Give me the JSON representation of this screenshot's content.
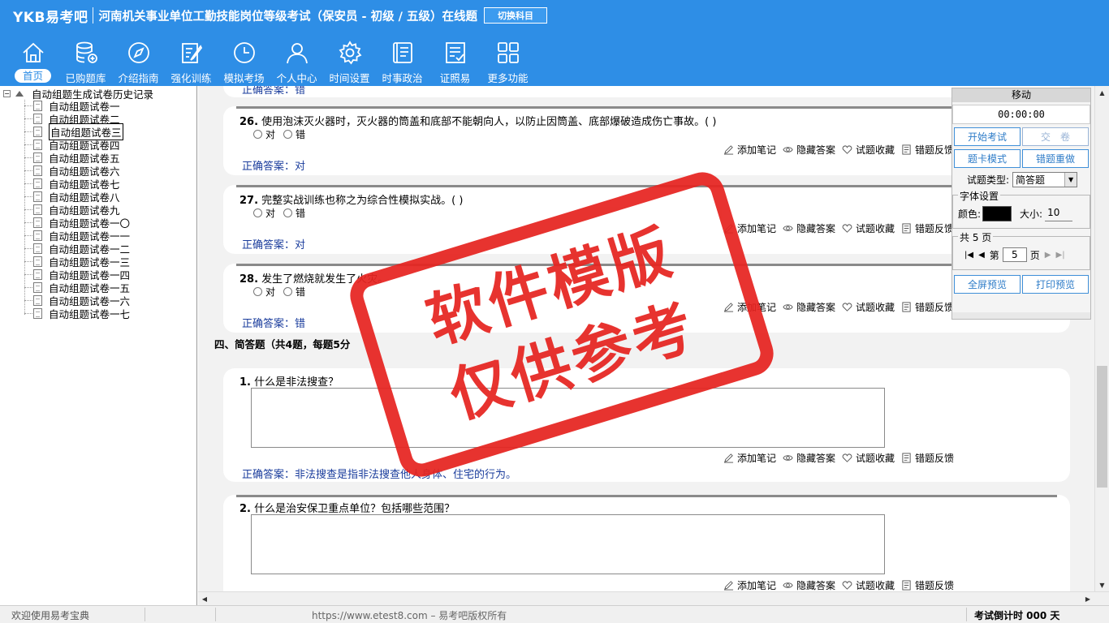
{
  "app": {
    "brand": "YKB易考吧",
    "title": "河南机关事业单位工勤技能岗位等级考试（保安员 - 初级 / 五级）在线题",
    "switch_subject": "切换科目"
  },
  "nav": [
    {
      "label": "首页",
      "icon": "home-icon"
    },
    {
      "label": "已购题库",
      "icon": "database-icon"
    },
    {
      "label": "介绍指南",
      "icon": "compass-icon"
    },
    {
      "label": "强化训练",
      "icon": "edit-icon"
    },
    {
      "label": "模拟考场",
      "icon": "clock-icon"
    },
    {
      "label": "个人中心",
      "icon": "user-icon"
    },
    {
      "label": "时间设置",
      "icon": "gear-icon"
    },
    {
      "label": "时事政治",
      "icon": "book-icon"
    },
    {
      "label": "证照易",
      "icon": "checklist-icon"
    },
    {
      "label": "更多功能",
      "icon": "grid-icon"
    }
  ],
  "tree": {
    "root": "自动组题生成试卷历史记录",
    "items": [
      "自动组题试卷一",
      "自动组题试卷二",
      "自动组题试卷三",
      "自动组题试卷四",
      "自动组题试卷五",
      "自动组题试卷六",
      "自动组题试卷七",
      "自动组题试卷八",
      "自动组题试卷九",
      "自动组题试卷一〇",
      "自动组题试卷一一",
      "自动组题试卷一二",
      "自动组题试卷一三",
      "自动组题试卷一四",
      "自动组题试卷一五",
      "自动组题试卷一六",
      "自动组题试卷一七"
    ],
    "selected_index": 2
  },
  "questions": {
    "partial_answer": "正确答案：错",
    "q26": {
      "num": "26.",
      "text": "使用泡沫灭火器时，灭火器的筒盖和底部不能朝向人，以防止因筒盖、底部爆破造成伤亡事故。( )",
      "opt_a": "对",
      "opt_b": "错",
      "answer": "正确答案：对"
    },
    "q27": {
      "num": "27.",
      "text": "完整实战训练也称之为综合性模拟实战。( )",
      "opt_a": "对",
      "opt_b": "错",
      "answer": "正确答案：对"
    },
    "q28": {
      "num": "28.",
      "text": "发生了燃烧就发生了火灾。",
      "opt_a": "对",
      "opt_b": "错",
      "answer": "正确答案：错"
    },
    "section": "四、简答题（共4题，每题5分",
    "s1": {
      "num": "1.",
      "text": "什么是非法搜查？",
      "answer": "正确答案：非法搜查是指非法搜查他人身体、住宅的行为。"
    },
    "s2": {
      "num": "2.",
      "text": "什么是治安保卫重点单位？包括哪些范围？"
    }
  },
  "actions": {
    "note": "添加笔记",
    "hide": "隐藏答案",
    "fav": "试题收藏",
    "feedback": "错题反馈"
  },
  "panel": {
    "header": "移动",
    "timer": "00:00:00",
    "start": "开始考试",
    "submit": "交　卷",
    "card_mode": "题卡模式",
    "redo": "错题重做",
    "type_label": "试题类型:",
    "type_value": "简答题",
    "font_legend": "字体设置",
    "color_label": "颜色:",
    "color_value": "#000000",
    "size_label": "大小:",
    "size_value": "10",
    "pages_legend": "共 5 页",
    "page_prefix": "第",
    "page_value": "5",
    "page_suffix": "页",
    "fullscreen": "全屏预览",
    "print": "打印预览"
  },
  "status": {
    "welcome": "欢迎使用易考宝典",
    "copyright": "https://www.etest8.com – 易考吧版权所有",
    "countdown": "考试倒计时 000 天"
  },
  "watermark": {
    "line1": "软件模版",
    "line2": "仅供参考"
  },
  "colors": {
    "header_bg": "#2e8ee6",
    "answer_text": "#1a3c9c",
    "stamp": "#e62420"
  }
}
